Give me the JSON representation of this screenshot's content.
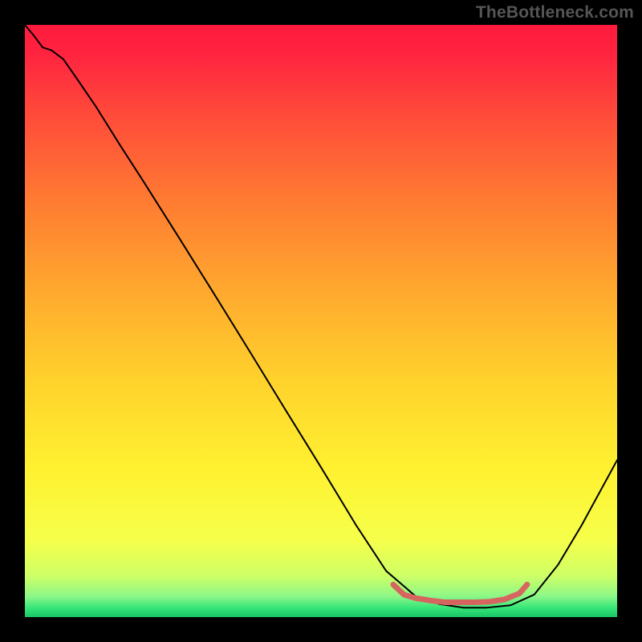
{
  "watermark": "TheBottleneck.com",
  "chart_data": {
    "type": "line",
    "title": "",
    "xlabel": "",
    "ylabel": "",
    "xlim": [
      0,
      1
    ],
    "ylim": [
      0,
      1
    ],
    "grid": false,
    "background": "vertical-gradient",
    "gradient_stops": [
      {
        "offset": 0.0,
        "color": "#ff1a3d"
      },
      {
        "offset": 0.05,
        "color": "#ff2440"
      },
      {
        "offset": 0.15,
        "color": "#ff4a3a"
      },
      {
        "offset": 0.3,
        "color": "#ff7c32"
      },
      {
        "offset": 0.45,
        "color": "#ffa92e"
      },
      {
        "offset": 0.6,
        "color": "#ffd22c"
      },
      {
        "offset": 0.75,
        "color": "#fff130"
      },
      {
        "offset": 0.87,
        "color": "#f6ff4a"
      },
      {
        "offset": 0.93,
        "color": "#ceff66"
      },
      {
        "offset": 0.965,
        "color": "#8cf787"
      },
      {
        "offset": 0.985,
        "color": "#34e57a"
      },
      {
        "offset": 1.0,
        "color": "#18c564"
      }
    ],
    "series": [
      {
        "name": "curve",
        "color": "#000000",
        "width": 2.0,
        "x": [
          0.0,
          0.015,
          0.03,
          0.045,
          0.065,
          0.09,
          0.12,
          0.16,
          0.2,
          0.26,
          0.32,
          0.38,
          0.44,
          0.5,
          0.56,
          0.61,
          0.66,
          0.7,
          0.74,
          0.78,
          0.82,
          0.86,
          0.9,
          0.94,
          0.97,
          1.0
        ],
        "y": [
          1.0,
          0.982,
          0.962,
          0.957,
          0.942,
          0.906,
          0.862,
          0.798,
          0.736,
          0.641,
          0.545,
          0.448,
          0.35,
          0.253,
          0.154,
          0.078,
          0.035,
          0.022,
          0.016,
          0.016,
          0.02,
          0.038,
          0.088,
          0.155,
          0.21,
          0.265
        ]
      },
      {
        "name": "bottom-marker",
        "color": "#d7655f",
        "width": 7.0,
        "x": [
          0.622,
          0.64,
          0.66,
          0.685,
          0.71,
          0.735,
          0.76,
          0.785,
          0.81,
          0.835,
          0.848
        ],
        "y": [
          0.055,
          0.038,
          0.032,
          0.028,
          0.025,
          0.025,
          0.025,
          0.026,
          0.03,
          0.04,
          0.055
        ]
      }
    ]
  }
}
